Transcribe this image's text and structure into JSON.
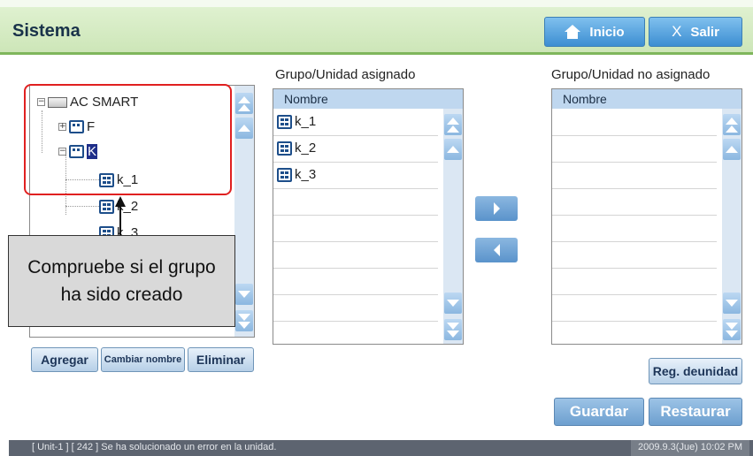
{
  "header": {
    "title": "Sistema",
    "home_label": "Inicio",
    "exit_label": "Salir",
    "exit_glyph": "X"
  },
  "tree": {
    "root": "AC SMART",
    "nodes": [
      {
        "label": "F",
        "type": "group",
        "expander": "+"
      },
      {
        "label": "K",
        "type": "group",
        "expander": "−",
        "selected": true
      },
      {
        "label": "k_1",
        "type": "unit"
      },
      {
        "label": "k_2",
        "type": "unit"
      },
      {
        "label": "k_3",
        "type": "unit"
      }
    ],
    "root_expander": "−"
  },
  "tree_buttons": {
    "add": "Agregar",
    "rename": "Cambiar nombre",
    "delete": "Eliminar"
  },
  "assigned": {
    "title": "Grupo/Unidad asignado",
    "header": "Nombre",
    "items": [
      "k_1",
      "k_2",
      "k_3"
    ]
  },
  "unassigned": {
    "title": "Grupo/Unidad no asignado",
    "header": "Nombre",
    "items": []
  },
  "unit_reg_button": "Reg. deunidad",
  "save_button": "Guardar",
  "restore_button": "Restaurar",
  "callout": {
    "line1": "Compruebe si el grupo",
    "line2": "ha sido creado"
  },
  "status": {
    "message": "[ Unit-1 ] [ 242 ] Se ha solucionado un error en la unidad.",
    "time": "2009.9.3(Jue)  10:02 PM"
  },
  "colors": {
    "header_bg": "#cde6b8",
    "accent_blue": "#3d8ed2",
    "highlight": "#e02020",
    "selected": "#1f2f8a"
  }
}
